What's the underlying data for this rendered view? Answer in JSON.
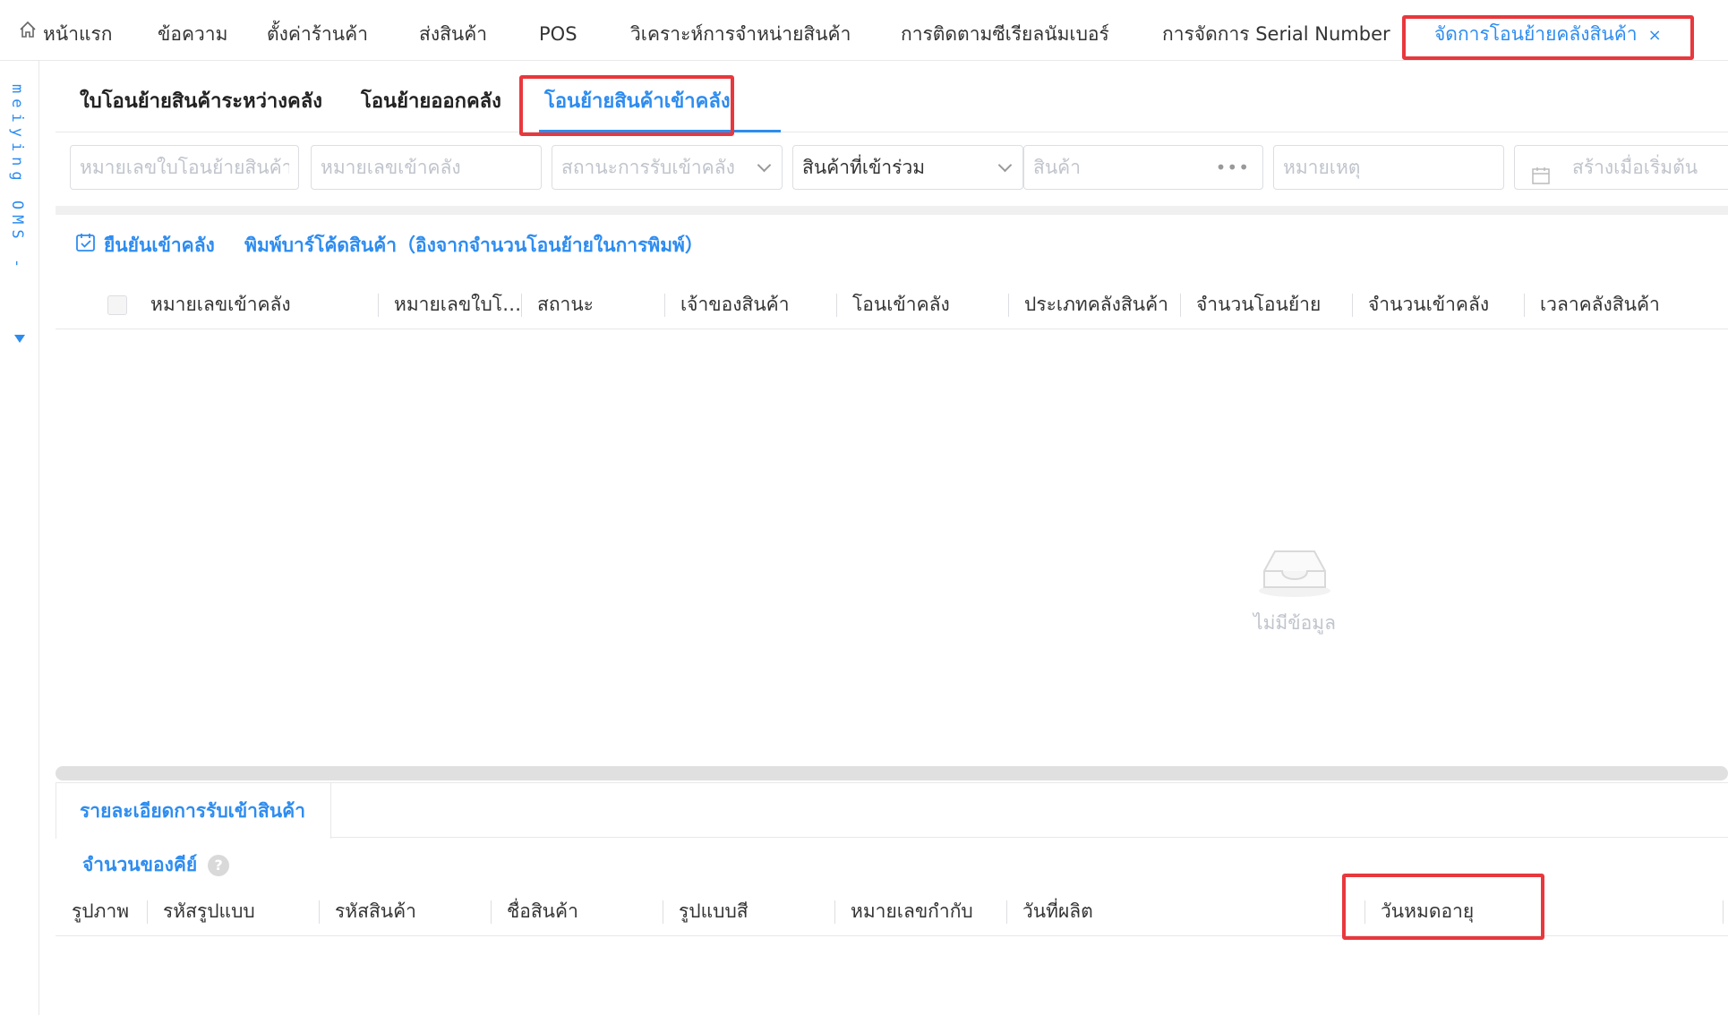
{
  "topnav": {
    "items": [
      {
        "label": "หน้าแรก",
        "icon": "home-icon"
      },
      {
        "label": "ข้อความ"
      },
      {
        "label": "ตั้งค่าร้านค้า"
      },
      {
        "label": "ส่งสินค้า"
      },
      {
        "label": "POS"
      },
      {
        "label": "วิเคราะห์การจำหน่ายสินค้า"
      },
      {
        "label": "การติดตามซีเรียลนัมเบอร์"
      },
      {
        "label": "การจัดการ Serial Number"
      },
      {
        "label": "จัดการโอนย้ายคลังสินค้า",
        "active": true,
        "closable": true
      }
    ],
    "close_glyph": "×"
  },
  "sidebar": {
    "brand": "meiying OMS -"
  },
  "subtabs": [
    {
      "label": "ใบโอนย้ายสินค้าระหว่างคลัง"
    },
    {
      "label": "โอนย้ายออกคลัง"
    },
    {
      "label": "โอนย้ายสินค้าเข้าคลัง",
      "active": true
    }
  ],
  "filters": {
    "transfer_no": {
      "placeholder": "หมายเลขใบโอนย้ายสินค้า"
    },
    "inbound_no": {
      "placeholder": "หมายเลขเข้าคลัง"
    },
    "receive_status": {
      "placeholder": "สถานะการรับเข้าคลัง"
    },
    "participating_goods": {
      "value": "สินค้าที่เข้าร่วม"
    },
    "goods": {
      "placeholder": "สินค้า"
    },
    "remark": {
      "placeholder": "หมายเหตุ"
    },
    "created_start": {
      "placeholder": "สร้างเมื่อเริ่มต้น"
    }
  },
  "toolbar": {
    "confirm_label": "ยืนยันเข้าคลัง",
    "print_label": "พิมพ์บาร์โค้ดสินค้า（อิงจากจำนวนโอนย้ายในการพิมพ์）"
  },
  "table": {
    "columns": [
      "หมายเลขเข้าคลัง",
      "หมายเลขใบโอนย้าย",
      "สถานะ",
      "เจ้าของสินค้า",
      "โอนเข้าคลัง",
      "ประเภทคลังสินค้า",
      "จำนวนโอนย้าย",
      "จำนวนเข้าคลัง",
      "เวลาคลังสินค้า"
    ],
    "empty_text": "ไม่มีข้อมูล"
  },
  "detail": {
    "tab_label": "รายละเอียดการรับเข้าสินค้า",
    "key_count_label": "จำนวนของคีย์",
    "help_glyph": "?",
    "columns": [
      "รูปภาพ",
      "รหัสรูปแบบ",
      "รหัสสินค้า",
      "ชื่อสินค้า",
      "รูปแบบสี",
      "หมายเลขกำกับ",
      "วันที่ผลิต",
      "วันหมดอายุ"
    ]
  },
  "colors": {
    "accent": "#2d8cf0",
    "highlight": "#e8383d"
  }
}
